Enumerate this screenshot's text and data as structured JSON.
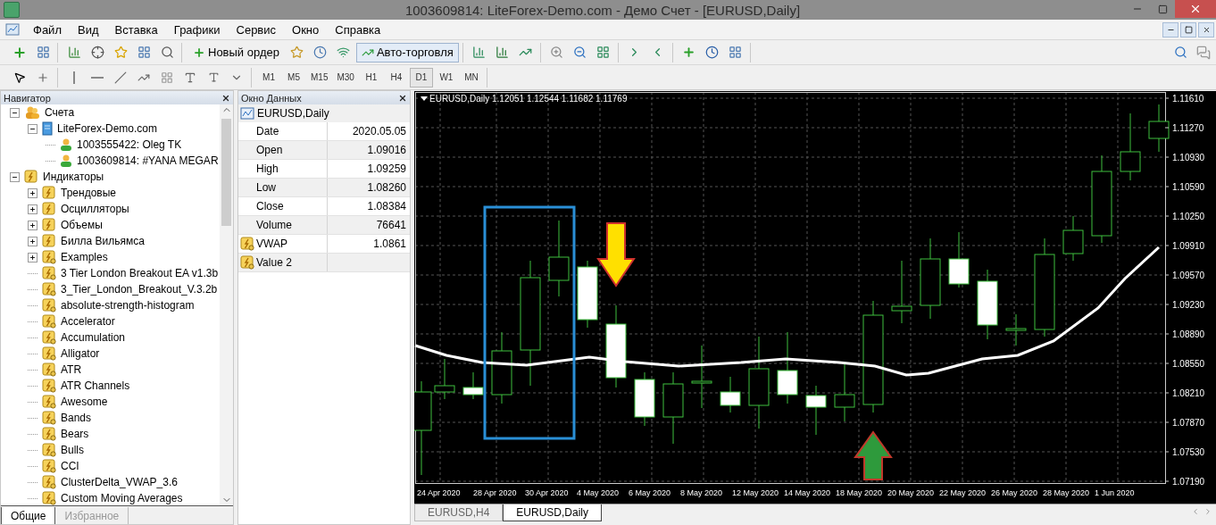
{
  "window": {
    "title": "1003609814: LiteForex-Demo.com - Демо Счет - [EURUSD,Daily]"
  },
  "menu": [
    {
      "label": "Файл"
    },
    {
      "label": "Вид"
    },
    {
      "label": "Вставка"
    },
    {
      "label": "Графики"
    },
    {
      "label": "Сервис"
    },
    {
      "label": "Окно"
    },
    {
      "label": "Справка"
    }
  ],
  "toolbar": {
    "new_order": "Новый ордер",
    "auto_trading": {
      "label": "Авто-торговля",
      "on": true
    }
  },
  "timeframes": [
    {
      "label": "M1",
      "selected": false
    },
    {
      "label": "M5",
      "selected": false
    },
    {
      "label": "M15",
      "selected": false
    },
    {
      "label": "M30",
      "selected": false
    },
    {
      "label": "H1",
      "selected": false
    },
    {
      "label": "H4",
      "selected": false
    },
    {
      "label": "D1",
      "selected": true
    },
    {
      "label": "W1",
      "selected": false
    },
    {
      "label": "MN",
      "selected": false
    }
  ],
  "navigator": {
    "title": "Навигатор",
    "tree": [
      {
        "label": "Счета",
        "kind": "accounts",
        "expanded": true,
        "children": [
          {
            "label": "LiteForex-Demo.com",
            "kind": "server",
            "expanded": true,
            "children": [
              {
                "label": "1003555422: Oleg TK",
                "kind": "account"
              },
              {
                "label": "1003609814: #YANA MEGAR",
                "kind": "account"
              }
            ]
          }
        ]
      },
      {
        "label": "Индикаторы",
        "kind": "folder",
        "expanded": true,
        "children": [
          {
            "label": "Трендовые",
            "kind": "folder",
            "expanded": false
          },
          {
            "label": "Осцилляторы",
            "kind": "folder",
            "expanded": false
          },
          {
            "label": "Объемы",
            "kind": "folder",
            "expanded": false
          },
          {
            "label": "Билла Вильямса",
            "kind": "folder",
            "expanded": false
          },
          {
            "label": "Examples",
            "kind": "indicator",
            "expanded": false
          },
          {
            "label": "3 Tier London Breakout EA v1.3b",
            "kind": "indicator"
          },
          {
            "label": "3_Tier_London_Breakout_V.3.2b",
            "kind": "indicator"
          },
          {
            "label": "absolute-strength-histogram",
            "kind": "indicator"
          },
          {
            "label": "Accelerator",
            "kind": "indicator"
          },
          {
            "label": "Accumulation",
            "kind": "indicator"
          },
          {
            "label": "Alligator",
            "kind": "indicator"
          },
          {
            "label": "ATR",
            "kind": "indicator"
          },
          {
            "label": "ATR Channels",
            "kind": "indicator"
          },
          {
            "label": "Awesome",
            "kind": "indicator"
          },
          {
            "label": "Bands",
            "kind": "indicator"
          },
          {
            "label": "Bears",
            "kind": "indicator"
          },
          {
            "label": "Bulls",
            "kind": "indicator"
          },
          {
            "label": "CCI",
            "kind": "indicator"
          },
          {
            "label": "ClusterDelta_VWAP_3.6",
            "kind": "indicator"
          },
          {
            "label": "Custom Moving Averages",
            "kind": "indicator"
          }
        ]
      }
    ],
    "tabs": [
      {
        "label": "Общие",
        "selected": true
      },
      {
        "label": "Избранное",
        "selected": false
      }
    ]
  },
  "data_window": {
    "title": "Окно Данных",
    "symbol": "EURUSD,Daily",
    "rows": [
      {
        "label": "Date",
        "value": "2020.05.05",
        "kind": "field"
      },
      {
        "label": "Open",
        "value": "1.09016",
        "kind": "field"
      },
      {
        "label": "High",
        "value": "1.09259",
        "kind": "field"
      },
      {
        "label": "Low",
        "value": "1.08260",
        "kind": "field"
      },
      {
        "label": "Close",
        "value": "1.08384",
        "kind": "field"
      },
      {
        "label": "Volume",
        "value": "76641",
        "kind": "field"
      },
      {
        "label": "VWAP",
        "value": "1.0861",
        "kind": "indicator"
      },
      {
        "label": "Value 2",
        "kind": "indicator"
      }
    ]
  },
  "chart": {
    "header": "EURUSD,Daily  1.12051 1.12544 1.11682 1.11769",
    "price_labels": [
      "1.11610",
      "1.11270",
      "1.10930",
      "1.10590",
      "1.10250",
      "1.09910",
      "1.09570",
      "1.09230",
      "1.08890",
      "1.08550",
      "1.08210",
      "1.07870",
      "1.07530",
      "1.07190"
    ],
    "date_labels": [
      "24 Apr 2020",
      "28 Apr 2020",
      "30 Apr 2020",
      "4 May 2020",
      "6 May 2020",
      "8 May 2020",
      "12 May 2020",
      "14 May 2020",
      "18 May 2020",
      "20 May 2020",
      "22 May 2020",
      "26 May 2020",
      "28 May 2020",
      "1 Jun 2020"
    ]
  },
  "chart_tabs": [
    {
      "label": "EURUSD,H4",
      "selected": false
    },
    {
      "label": "EURUSD,Daily",
      "selected": true
    }
  ]
}
